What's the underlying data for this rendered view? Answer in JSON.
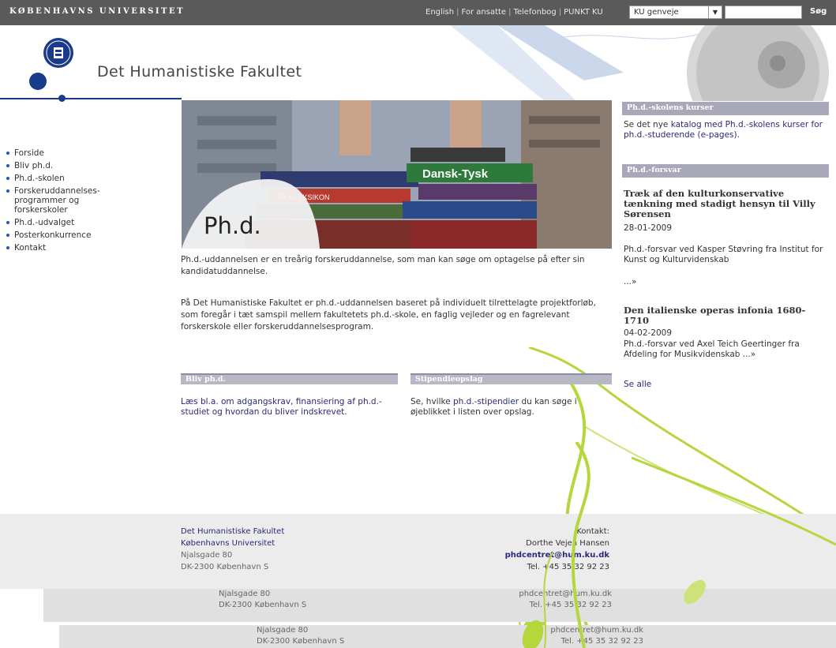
{
  "topbar": {
    "brand": "KØBENHAVNS UNIVERSITET",
    "links": [
      "English",
      "For ansatte",
      "Telefonbog",
      "PUNKT KU"
    ],
    "link_separator": "|",
    "shortcut_select": "KU genveje",
    "search_button": "Søg"
  },
  "header": {
    "faculty_title": "Det Humanistiske Fakultet"
  },
  "nav": {
    "items": [
      "Forside",
      "Bliv ph.d.",
      "Ph.d.-skolen",
      "Forskeruddannelses-programmer og forskerskoler",
      "Ph.d.-udvalget",
      "Posterkonkurrence",
      "Kontakt"
    ]
  },
  "hero": {
    "title": "Ph.d.",
    "book_label_1": "Dansk-Tysk",
    "book_label_2": "FILMLEKSIKON"
  },
  "main": {
    "intro": "Ph.d.-uddannelsen er en treårig forskeruddannelse, som man kan søge om optagelse på efter sin kandidatuddannelse.",
    "body": "På Det Humanistiske Fakultet er ph.d.-uddannelsen baseret på individuelt tilrettelagte projektforløb, som foregår i tæt samspil mellem fakultetets ph.d.-skole, en faglig vejleder og en fagrelevant forskerskole eller forskeruddannelsesprogram."
  },
  "boxes": {
    "bliv": {
      "title": "Bliv ph.d.",
      "text_pre": "Læs bl.a. om ",
      "link": "adgangskrav, finansiering af ph.d.-studiet og hvordan du bliver indskrevet",
      "text_post": "."
    },
    "stip": {
      "title": "Stipendieopslag",
      "text_pre": "Se, hvilke ",
      "link": "ph.d.-stipendier",
      "text_post": " du kan søge i øjeblikket i listen over opslag."
    }
  },
  "right": {
    "kurser_title": "Ph.d.-skolens kurser",
    "kurser_pre": "Se det nye ",
    "kurser_link": "katalog med Ph.d.-skolens kurser for ph.d.-studerende (e-pages).",
    "forsvar_title": "Ph.d.-forsvar",
    "items": [
      {
        "title": "Træk af den kulturkonservative tænkning med stadigt hensyn til Villy Sørensen",
        "date": "28-01-2009",
        "desc": "Ph.d.-forsvar ved Kasper Støvring fra Institut for Kunst og Kulturvidenskab",
        "more": "...»"
      },
      {
        "title": "Den italienske operas infonia 1680-1710",
        "date": "04-02-2009",
        "desc": "Ph.d.-forsvar ved Axel Teich Geertinger fra Afdeling for Musikvidenskab ...»",
        "more": ""
      }
    ],
    "see_all": "Se alle"
  },
  "footer": {
    "org1": "Det Humanistiske Fakultet",
    "org2": "Københavns Universitet",
    "addr1": "Njalsgade 80",
    "addr2": "DK-2300 København S",
    "contact_label": "Kontakt:",
    "contact_name": "Dorthe Vejen Hansen",
    "email": "phdcentret@hum.ku.dk",
    "phone": "Tel. +45 35 32 92 23"
  },
  "ghosts": [
    {
      "addr1": "Njalsgade 80",
      "addr2": "DK-2300 København S",
      "email": "phdcentret@hum.ku.dk",
      "phone": "Tel. +45 35 32 92 23"
    },
    {
      "addr1": "Njalsgade 80",
      "addr2": "DK-2300 København S",
      "email": "phdcentret@hum.ku.dk",
      "phone": "Tel. +45 35 32 92 23"
    }
  ],
  "colors": {
    "topbar": "#5a5a5a",
    "brand_blue": "#1a3a8a",
    "link": "#2a2a7a",
    "section_bar": "#a8a8b8",
    "vine_green": "#b5d63d"
  }
}
